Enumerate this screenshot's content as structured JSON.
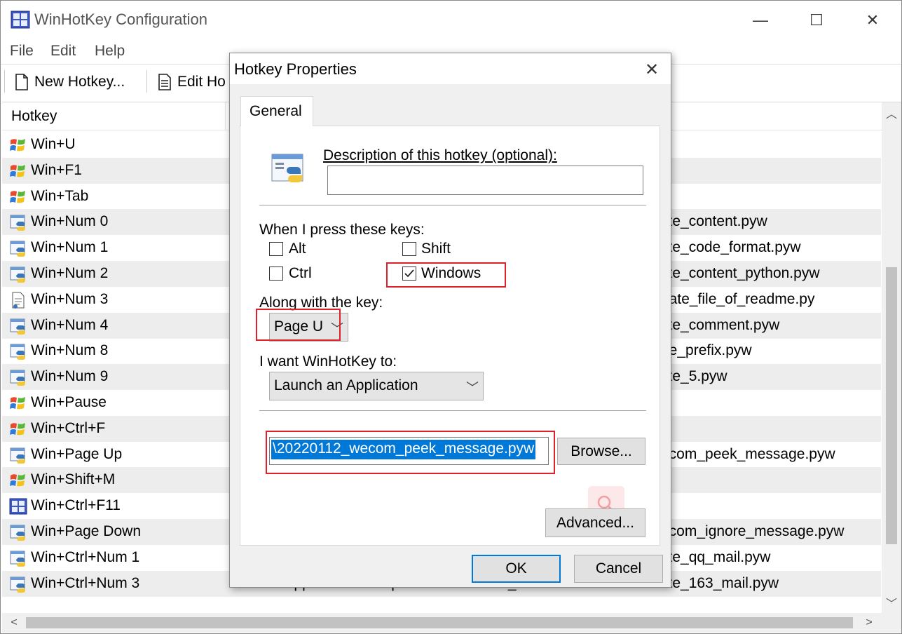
{
  "window": {
    "title": "WinHotKey Configuration",
    "controls": {
      "minimize": "—",
      "maximize": "☐",
      "close": "✕"
    }
  },
  "menu": [
    "File",
    "Edit",
    "Help"
  ],
  "toolbar": {
    "new_hotkey": "New Hotkey...",
    "edit_hotkey": "Edit Ho"
  },
  "list": {
    "column_hotkey": "Hotkey",
    "rows": [
      {
        "key": "Win+U",
        "icon": "windows-flag-icon",
        "target": ""
      },
      {
        "key": "Win+F1",
        "icon": "windows-flag-icon",
        "target": ""
      },
      {
        "key": "Win+Tab",
        "icon": "windows-flag-icon",
        "target": ""
      },
      {
        "key": "Win+Num 0",
        "icon": "python-script-icon",
        "target": "ste_content.pyw"
      },
      {
        "key": "Win+Num 1",
        "icon": "python-script-icon",
        "target": "ste_code_format.pyw"
      },
      {
        "key": "Win+Num 2",
        "icon": "python-script-icon",
        "target": "ste_content_python.pyw"
      },
      {
        "key": "Win+Num 3",
        "icon": "document-script-icon",
        "target": "eate_file_of_readme.py"
      },
      {
        "key": "Win+Num 4",
        "icon": "python-script-icon",
        "target": "ste_comment.pyw"
      },
      {
        "key": "Win+Num 8",
        "icon": "python-script-icon",
        "target": "ne_prefix.pyw"
      },
      {
        "key": "Win+Num 9",
        "icon": "python-script-icon",
        "target": "ste_5.pyw"
      },
      {
        "key": "Win+Pause",
        "icon": "windows-flag-icon",
        "target": ""
      },
      {
        "key": "Win+Ctrl+F",
        "icon": "windows-flag-icon",
        "target": ""
      },
      {
        "key": "Win+Page Up",
        "icon": "python-script-icon",
        "target": "ecom_peek_message.pyw"
      },
      {
        "key": "Win+Shift+M",
        "icon": "windows-flag-icon",
        "target": ""
      },
      {
        "key": "Win+Ctrl+F11",
        "icon": "app-window-icon",
        "target": ""
      },
      {
        "key": "Win+Page Down",
        "icon": "python-script-icon",
        "target": "ecom_ignore_message.pyw"
      },
      {
        "key": "Win+Ctrl+Num 1",
        "icon": "python-script-icon",
        "target": "ste_qq_mail.pyw"
      },
      {
        "key": "Win+Ctrl+Num 3",
        "icon": "python-script-icon",
        "target": "ste_163_mail.pyw",
        "mid": "Launch applica...   D:\\Dropbox\\...\\20220112_"
      }
    ]
  },
  "dialog": {
    "title": "Hotkey Properties",
    "close": "✕",
    "tab_general": "General",
    "description_label": "Description of this hotkey (optional):",
    "description_value": "",
    "keys_label": "When I press these keys:",
    "modifiers": {
      "alt": {
        "label": "Alt",
        "checked": false
      },
      "shift": {
        "label": "Shift",
        "checked": false
      },
      "ctrl": {
        "label": "Ctrl",
        "checked": false
      },
      "windows": {
        "label": "Windows",
        "checked": true
      }
    },
    "key_label": "Along with the key:",
    "key_value": "Page U",
    "action_label": "I want WinHotKey to:",
    "action_value": "Launch an Application",
    "path_value": "\\20220112_wecom_peek_message.pyw",
    "browse": "Browse...",
    "advanced": "Advanced...",
    "ok": "OK",
    "cancel": "Cancel",
    "highlight_color": "#e0202a",
    "selection_color": "#0078d7"
  }
}
